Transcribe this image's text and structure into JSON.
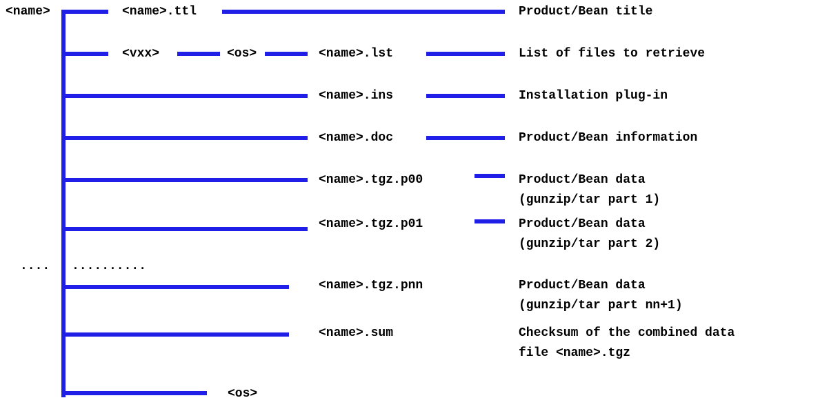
{
  "colors": {
    "line": "#1f1fe8",
    "text": "#000000",
    "background": "#ffffff"
  },
  "tree": {
    "root": "<name>",
    "left_dots": "....",
    "right_dots": "..........",
    "title_file": "<name>.ttl",
    "version_dir": "<vxx>",
    "os_dir": "<os>",
    "list_file": "<name>.lst",
    "ins_file": "<name>.ins",
    "doc_file": "<name>.doc",
    "p00_file": "<name>.tgz.p00",
    "p01_file": "<name>.tgz.p01",
    "pnn_file": "<name>.tgz.pnn",
    "sum_file": "<name>.sum",
    "os_leaf": "<os>"
  },
  "descriptions": {
    "ttl": "Product/Bean title",
    "lst": "List of files to retrieve",
    "ins": "Installation plug-in",
    "doc": "Product/Bean information",
    "p00_line1": "Product/Bean data",
    "p00_line2": "(gunzip/tar part 1)",
    "p01_line1": "Product/Bean data",
    "p01_line2": "(gunzip/tar part 2)",
    "pnn_line1": "Product/Bean data",
    "pnn_line2": "(gunzip/tar part nn+1)",
    "sum_line1": "Checksum of the combined data",
    "sum_line2": "file <name>.tgz"
  }
}
